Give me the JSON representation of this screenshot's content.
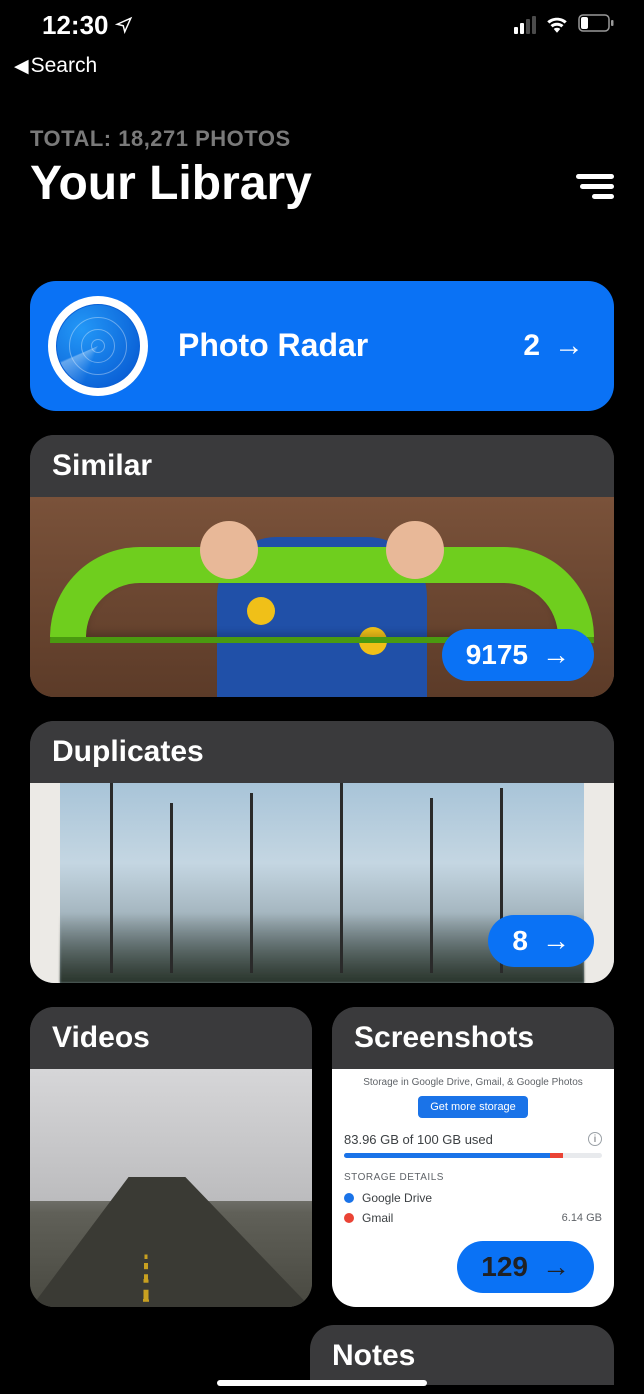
{
  "status_bar": {
    "time": "12:30",
    "back_label": "Search"
  },
  "header": {
    "total_label": "TOTAL: 18,271 PHOTOS",
    "title": "Your Library"
  },
  "radar": {
    "title": "Photo Radar",
    "count": "2"
  },
  "similar": {
    "label": "Similar",
    "count": "9175"
  },
  "duplicates": {
    "label": "Duplicates",
    "count": "8"
  },
  "videos": {
    "label": "Videos"
  },
  "screenshots": {
    "label": "Screenshots",
    "count": "129",
    "inner": {
      "storage_line": "Storage in Google Drive, Gmail, & Google Photos",
      "button": "Get more storage",
      "used": "83.96 GB of 100 GB used",
      "details_label": "STORAGE DETAILS",
      "item1": "Google Drive",
      "item2": "Gmail",
      "size2": "6.14 GB"
    }
  },
  "notes": {
    "label": "Notes"
  }
}
